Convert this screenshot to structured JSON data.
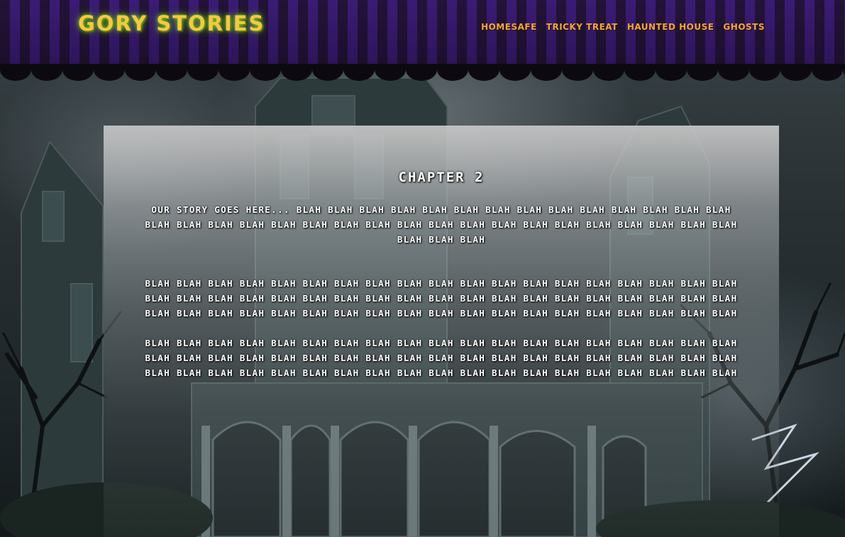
{
  "header": {
    "logo": "GORY STORIES",
    "nav": [
      {
        "label": "HOMESAFE"
      },
      {
        "label": "TRICKY TREAT"
      },
      {
        "label": "HAUNTED HOUSE"
      },
      {
        "label": "GHOSTS"
      }
    ]
  },
  "main": {
    "title": "CHAPTER 2",
    "paragraphs": [
      "OUR STORY GOES HERE... BLAH BLAH BLAH BLAH BLAH BLAH BLAH BLAH BLAH BLAH BLAH BLAH BLAH BLAH BLAH BLAH BLAH BLAH BLAH BLAH BLAH BLAH BLAH BLAH BLAH BLAH BLAH BLAH BLAH BLAH BLAH BLAH BLAH BLAH BLAH BLAH",
      "BLAH BLAH BLAH BLAH BLAH BLAH BLAH BLAH BLAH BLAH BLAH BLAH BLAH BLAH BLAH BLAH BLAH BLAH BLAH BLAH BLAH BLAH BLAH BLAH BLAH BLAH BLAH BLAH BLAH BLAH BLAH BLAH BLAH BLAH BLAH BLAH BLAH BLAH BLAH BLAH BLAH BLAH BLAH BLAH BLAH BLAH BLAH BLAH BLAH BLAH BLAH BLAH BLAH BLAH BLAH BLAH BLAH",
      "BLAH BLAH BLAH BLAH BLAH BLAH BLAH BLAH BLAH BLAH BLAH BLAH BLAH BLAH BLAH BLAH BLAH BLAH BLAH BLAH BLAH BLAH BLAH BLAH BLAH BLAH BLAH BLAH BLAH BLAH BLAH BLAH BLAH BLAH BLAH BLAH BLAH BLAH BLAH BLAH BLAH BLAH BLAH BLAH BLAH BLAH BLAH BLAH BLAH BLAH BLAH BLAH BLAH BLAH BLAH BLAH BLAH"
    ]
  },
  "colors": {
    "stripe_dark": "#2a1642",
    "stripe_light": "#45208a",
    "logo": "#f4c842",
    "logo_glow": "#7cd12a",
    "nav_link": "#f2a63c",
    "story_text": "#ffffff"
  }
}
